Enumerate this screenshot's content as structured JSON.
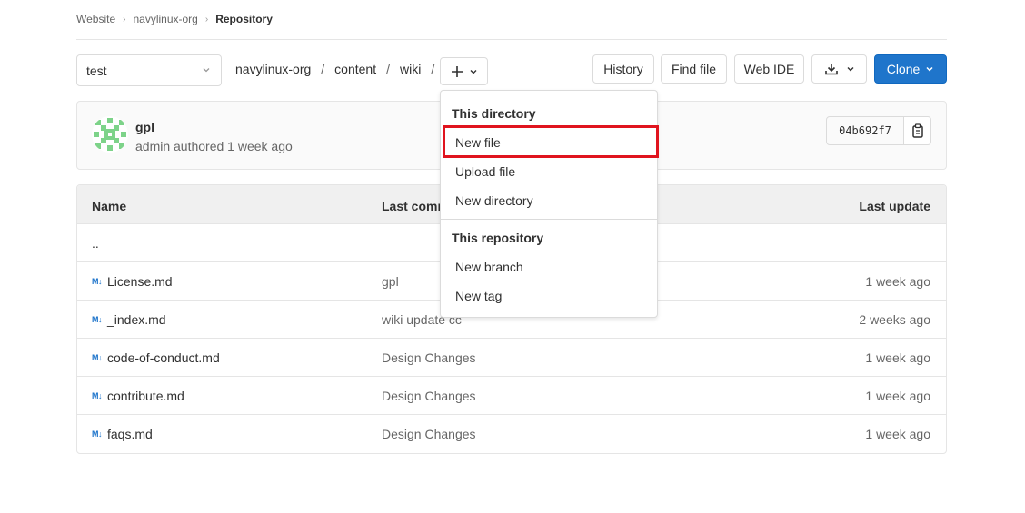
{
  "breadcrumb": {
    "items": [
      "Website",
      "navylinux-org"
    ],
    "current": "Repository"
  },
  "branch": {
    "selected": "test"
  },
  "path": {
    "segments": [
      "navylinux-org",
      "content",
      "wiki"
    ]
  },
  "toolbar": {
    "history_label": "History",
    "find_file_label": "Find file",
    "web_ide_label": "Web IDE",
    "clone_label": "Clone"
  },
  "commit": {
    "title": "gpl",
    "meta": "admin authored 1 week ago",
    "sha": "04b692f7"
  },
  "table": {
    "headers": {
      "name": "Name",
      "last_commit": "Last comm",
      "last_update": "Last update"
    },
    "parent": "..",
    "rows": [
      {
        "name": "License.md",
        "commit": "gpl",
        "updated": "1 week ago"
      },
      {
        "name": "_index.md",
        "commit": "wiki update cc",
        "updated": "2 weeks ago"
      },
      {
        "name": "code-of-conduct.md",
        "commit": "Design Changes",
        "updated": "1 week ago"
      },
      {
        "name": "contribute.md",
        "commit": "Design Changes",
        "updated": "1 week ago"
      },
      {
        "name": "faqs.md",
        "commit": "Design Changes",
        "updated": "1 week ago"
      }
    ]
  },
  "dropdown": {
    "directory_header": "This directory",
    "new_file": "New file",
    "upload_file": "Upload file",
    "new_directory": "New directory",
    "repository_header": "This repository",
    "new_branch": "New branch",
    "new_tag": "New tag"
  },
  "icons": {
    "md": "M↓"
  },
  "colors": {
    "accent": "#1f75cb",
    "highlight": "#e0141e"
  }
}
